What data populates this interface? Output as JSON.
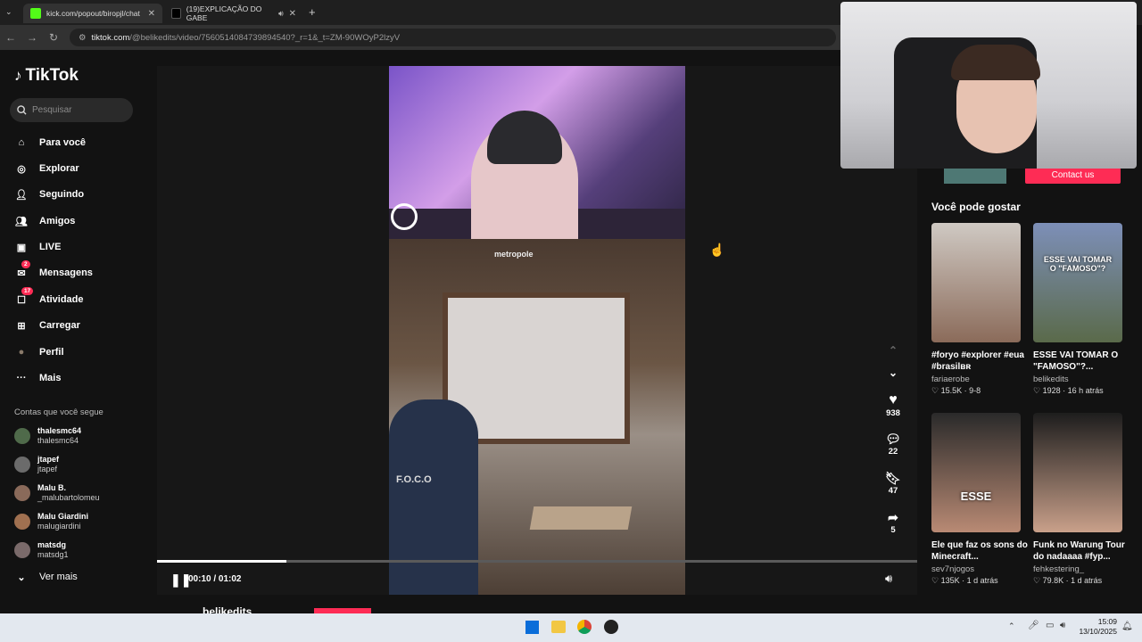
{
  "browser": {
    "tabs": [
      {
        "title": "kick.com/popout/biropjl/chat",
        "favicon_color": "#53fc18"
      },
      {
        "title": "(19)EXPLICAÇÃO DO GABE",
        "favicon_color": "#000000"
      }
    ],
    "url_domain": "tiktok.com",
    "url_path": "/@belikedits/video/7560514084739894540?_r=1&_t=ZM-90WOyP2lzyV"
  },
  "sidebar": {
    "logo": "TikTok",
    "search_placeholder": "Pesquisar",
    "items": [
      {
        "label": "Para você",
        "icon": "home-icon"
      },
      {
        "label": "Explorar",
        "icon": "compass-icon"
      },
      {
        "label": "Seguindo",
        "icon": "following-icon"
      },
      {
        "label": "Amigos",
        "icon": "friends-icon"
      },
      {
        "label": "LIVE",
        "icon": "live-icon"
      },
      {
        "label": "Mensagens",
        "icon": "messages-icon",
        "badge": "2"
      },
      {
        "label": "Atividade",
        "icon": "activity-icon",
        "badge": "17"
      },
      {
        "label": "Carregar",
        "icon": "upload-icon"
      },
      {
        "label": "Perfil",
        "icon": "avatar-icon"
      },
      {
        "label": "Mais",
        "icon": "more-icon"
      }
    ],
    "following_header": "Contas que você segue",
    "accounts": [
      {
        "name": "thalesmc64",
        "handle": "thalesmc64"
      },
      {
        "name": "jtapef",
        "handle": "jtapef"
      },
      {
        "name": "Malu B.",
        "handle": "_malubartolomeu"
      },
      {
        "name": "Malu Giardini",
        "handle": "malugiardini"
      },
      {
        "name": "matsdg",
        "handle": "matsdg1"
      }
    ],
    "see_more": "Ver mais"
  },
  "player": {
    "time": "00:10 / 01:02",
    "progress": 0.17,
    "watermark": "metropole",
    "vest_text": "F.O.C.O",
    "likes": "938",
    "comments": "22",
    "saves": "47",
    "shares": "5",
    "author": "belikedits"
  },
  "right": {
    "contact_label": "Contact us",
    "rec_title": "Você pode gostar",
    "cards": [
      {
        "caption": "#foryo #explorer #eua #brasilʙʀ",
        "user": "fariaerobe",
        "likes": "15.5K",
        "date": "9-8"
      },
      {
        "caption": "ESSE VAI TOMAR O \"FAMOSO\"?...",
        "user": "belikedits",
        "likes": "1928",
        "date": "16 h atrás",
        "thumb_text": "ESSE VAI TOMAR O \"FAMOSO\"?"
      },
      {
        "caption": "Ele que faz os sons do Minecraft...",
        "user": "sev7njogos",
        "likes": "135K",
        "date": "1 d atrás",
        "thumb_text": "ESSE"
      },
      {
        "caption": "Funk no Warung Tour do nadaaaa #fyp...",
        "user": "fehkestering_",
        "likes": "79.8K",
        "date": "1 d atrás"
      }
    ]
  },
  "taskbar": {
    "time": "15:09",
    "date": "13/10/2025"
  }
}
